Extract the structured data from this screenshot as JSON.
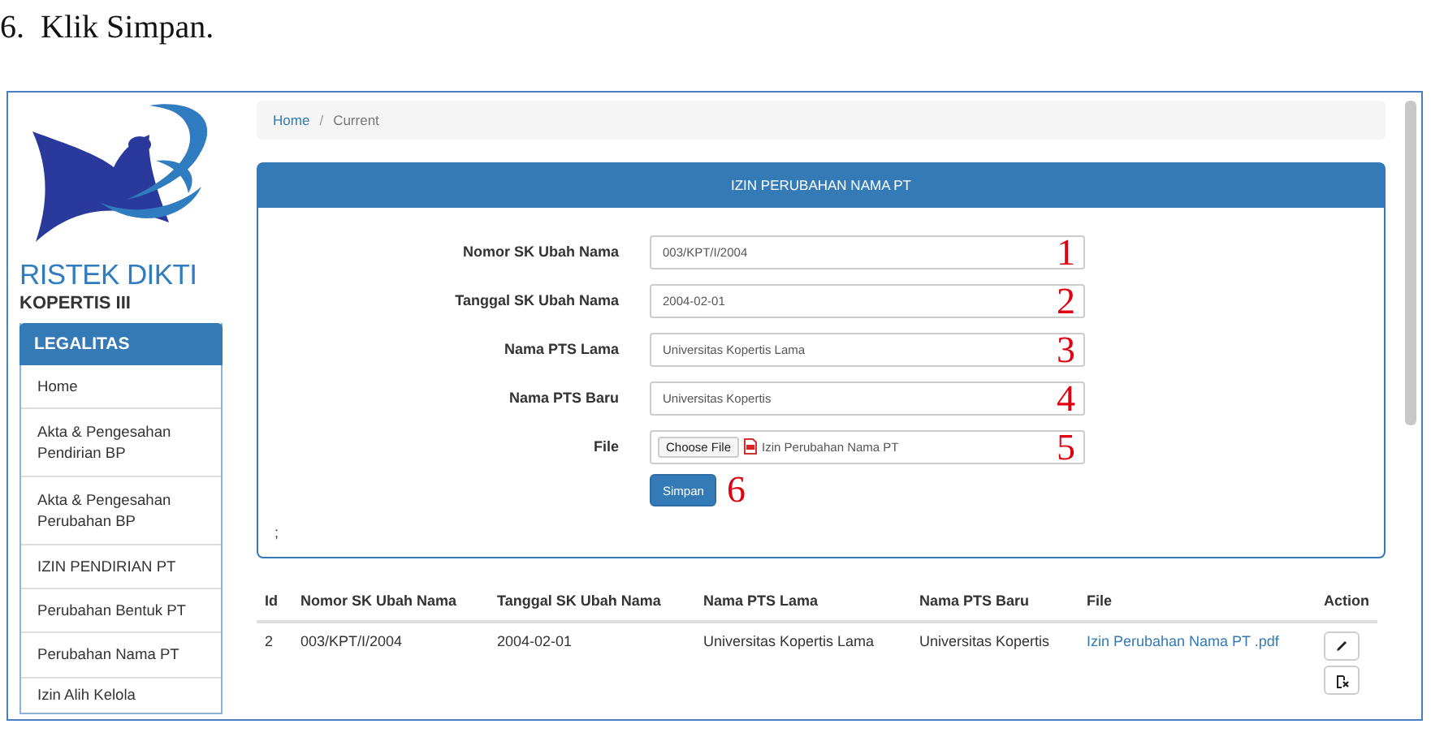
{
  "document": {
    "step_number": "6.",
    "step_text": "Klik Simpan."
  },
  "app": {
    "brand": "RISTEK DIKTI",
    "org": "KOPERTIS III",
    "sidebar": {
      "title": "LEGALITAS",
      "items": [
        {
          "label": "Home"
        },
        {
          "label": "Akta & Pengesahan Pendirian BP"
        },
        {
          "label": "Akta & Pengesahan Perubahan BP"
        },
        {
          "label": "IZIN PENDIRIAN PT"
        },
        {
          "label": "Perubahan Bentuk PT"
        },
        {
          "label": "Perubahan Nama PT"
        },
        {
          "label": "Izin Alih Kelola"
        }
      ]
    },
    "breadcrumb": [
      {
        "label": "Home",
        "kind": "link"
      },
      {
        "label": "/",
        "kind": "separator"
      },
      {
        "label": "Current",
        "kind": "current"
      }
    ],
    "form": {
      "title": "IZIN PERUBAHAN NAMA PT",
      "fields": [
        {
          "kind": "text",
          "label": "Nomor SK Ubah Nama",
          "value": "003/KPT/I/2004",
          "annotation": "1"
        },
        {
          "kind": "text",
          "label": "Tanggal SK Ubah Nama",
          "value": "2004-02-01",
          "annotation": "2"
        },
        {
          "kind": "text",
          "label": "Nama PTS Lama",
          "value": "Universitas Kopertis Lama",
          "annotation": "3"
        },
        {
          "kind": "text",
          "label": "Nama PTS Baru",
          "value": "Universitas Kopertis",
          "annotation": "4"
        },
        {
          "kind": "file",
          "label": "File",
          "button": "Choose File",
          "value": "Izin Perubahan Nama PT",
          "annotation": "5"
        }
      ],
      "submit": {
        "label": "Simpan",
        "annotation": "6"
      },
      "note": ";"
    },
    "table": {
      "columns": [
        "Id",
        "Nomor SK Ubah Nama",
        "Tanggal SK Ubah Nama",
        "Nama PTS Lama",
        "Nama PTS Baru",
        "File",
        "Action"
      ],
      "rows": [
        {
          "cells": [
            "2",
            "003/KPT/I/2004",
            "2004-02-01",
            "Universitas Kopertis Lama",
            "Universitas Kopertis"
          ],
          "file": "Izin Perubahan Nama PT .pdf"
        }
      ]
    }
  }
}
